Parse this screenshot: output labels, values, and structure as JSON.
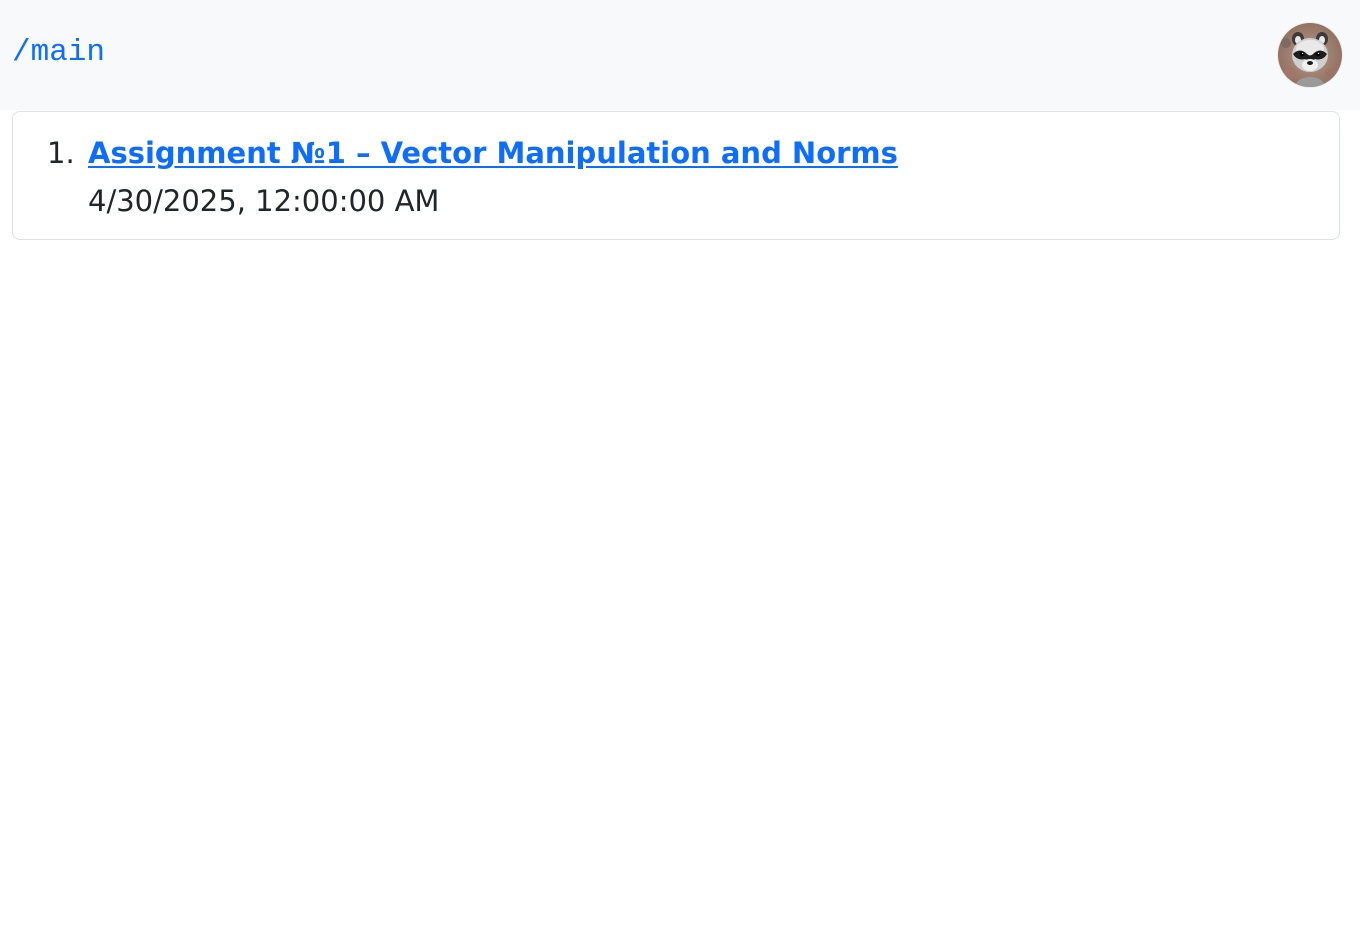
{
  "header": {
    "path_link": "/main",
    "avatar_icon": "raccoon-avatar-icon"
  },
  "assignments": {
    "items": [
      {
        "number": "1.",
        "title": "Assignment №1 – Vector Manipulation and Norms",
        "date": "4/30/2025, 12:00:00 AM"
      }
    ]
  },
  "colors": {
    "link": "#0d6efd",
    "header_bg": "#f8f9fa",
    "border": "#dee2e6",
    "text": "#212529"
  }
}
